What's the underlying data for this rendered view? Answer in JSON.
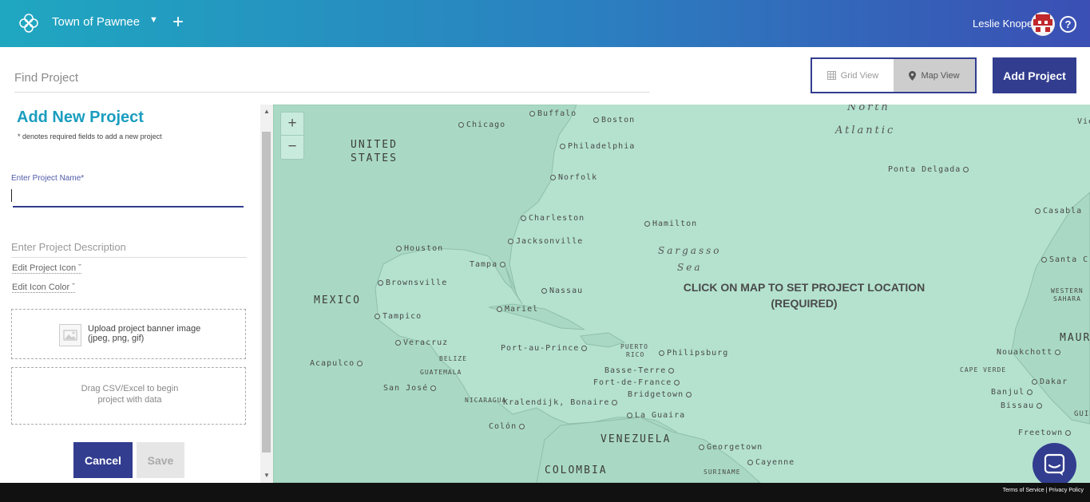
{
  "header": {
    "org_name": "Town of Pawnee",
    "user_name": "Leslie Knope",
    "help_glyph": "?"
  },
  "toolbar": {
    "find_placeholder": "Find Project",
    "grid_view_label": "Grid View",
    "map_view_label": "Map View",
    "active_view": "Map View",
    "add_project_label": "Add Project"
  },
  "panel": {
    "title": "Add New Project",
    "required_note": "* denotes required fields to add a new project",
    "name_label": "Enter Project Name*",
    "name_value": "",
    "description_placeholder": "Enter Project Description",
    "edit_icon_label": "Edit Project Icon ˇ",
    "edit_color_label": "Edit Icon Color ˇ",
    "upload_line1": "Upload project banner image",
    "upload_line2": "(jpeg, png, gif)",
    "csv_text": "Drag CSV/Excel to begin project with data",
    "cancel_label": "Cancel",
    "save_label": "Save"
  },
  "map": {
    "zoom_in": "+",
    "zoom_out": "−",
    "instruction_line1": "CLICK ON MAP TO SET PROJECT LOCATION",
    "instruction_line2": "(REQUIRED)",
    "water_color": "#b4e2cf",
    "land_color": "#a9d9c4",
    "cities": [
      "Chicago",
      "Buffalo",
      "Boston",
      "Philadelphia",
      "Norfolk",
      "Charleston",
      "Jacksonville",
      "Houston",
      "Tampa",
      "Brownsville",
      "Nassau",
      "Tampico",
      "Mariel",
      "Veracruz",
      "Port-au-Prince",
      "Acapulco",
      "Philipsburg",
      "Basse-Terre",
      "Fort-de-France",
      "Bridgetown",
      "San José",
      "Kralendijk, Bonaire",
      "La Guaira",
      "Colón",
      "Georgetown",
      "Cayenne",
      "Hamilton",
      "Ponta Delgada",
      "Casabla",
      "Santa C",
      "Nouakchott",
      "Dakar",
      "Banjul",
      "Bissau",
      "Freetown"
    ],
    "regions": [
      "UNITED",
      "STATES",
      "MEXICO",
      "VENEZUELA",
      "COLOMBIA",
      "MAURI",
      "BELIZE",
      "GUATEMALA",
      "NICARAGUA",
      "PUERTO",
      "RICO",
      "CAPE VERDE",
      "WESTERN",
      "SAHARA",
      "GUIN",
      "SURINAME"
    ],
    "ocean_labels": [
      "North",
      "Atlantic",
      "Sargasso",
      "Sea",
      "Vie"
    ]
  },
  "footer": {
    "terms": "Terms of Service",
    "separator": "|",
    "privacy": "Privacy Policy"
  },
  "colors": {
    "brand_dark": "#323d8f",
    "brand_teal": "#1a9dbf"
  }
}
